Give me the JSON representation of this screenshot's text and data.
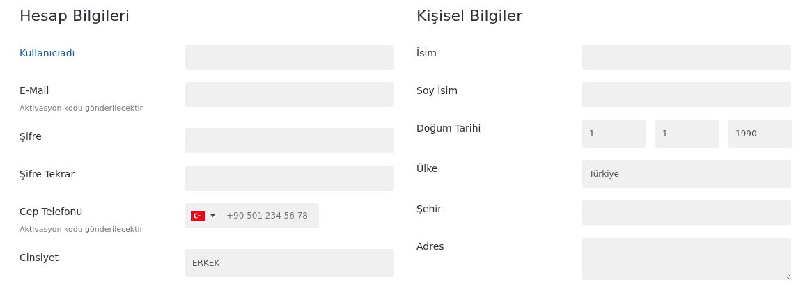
{
  "sections": [
    {
      "title": "Hesap Bilgileri",
      "fields": [
        {
          "kind": "text",
          "label": "Kullanıcıadı",
          "active": true
        },
        {
          "kind": "text",
          "label": "E-Mail",
          "hint": "Aktivasyon kodu gönderilecektir",
          "active": false
        },
        {
          "kind": "text",
          "label": "Şifre",
          "active": false
        },
        {
          "kind": "text",
          "label": "Şifre Tekrar",
          "active": false
        },
        {
          "kind": "phone",
          "label": "Cep Telefonu",
          "placeholder": "+90 501 234 56 78",
          "hint": "Aktivasyon kodu gönderilecektir",
          "active": false
        },
        {
          "kind": "select",
          "label": "Cinsiyet",
          "value": "ERKEK",
          "active": false
        }
      ]
    },
    {
      "title": "Kişisel Bilgiler",
      "fields": [
        {
          "kind": "text",
          "label": "İsim",
          "active": false
        },
        {
          "kind": "text",
          "label": "Soy İsim",
          "active": false
        },
        {
          "kind": "date",
          "label": "Doğum Tarihi",
          "parts": [
            "1",
            "1",
            "1990"
          ],
          "active": false
        },
        {
          "kind": "select",
          "label": "Ülke",
          "value": "Türkiye",
          "active": false
        },
        {
          "kind": "text",
          "label": "Şehir",
          "active": false
        },
        {
          "kind": "textarea",
          "label": "Adres",
          "active": false
        }
      ]
    }
  ]
}
